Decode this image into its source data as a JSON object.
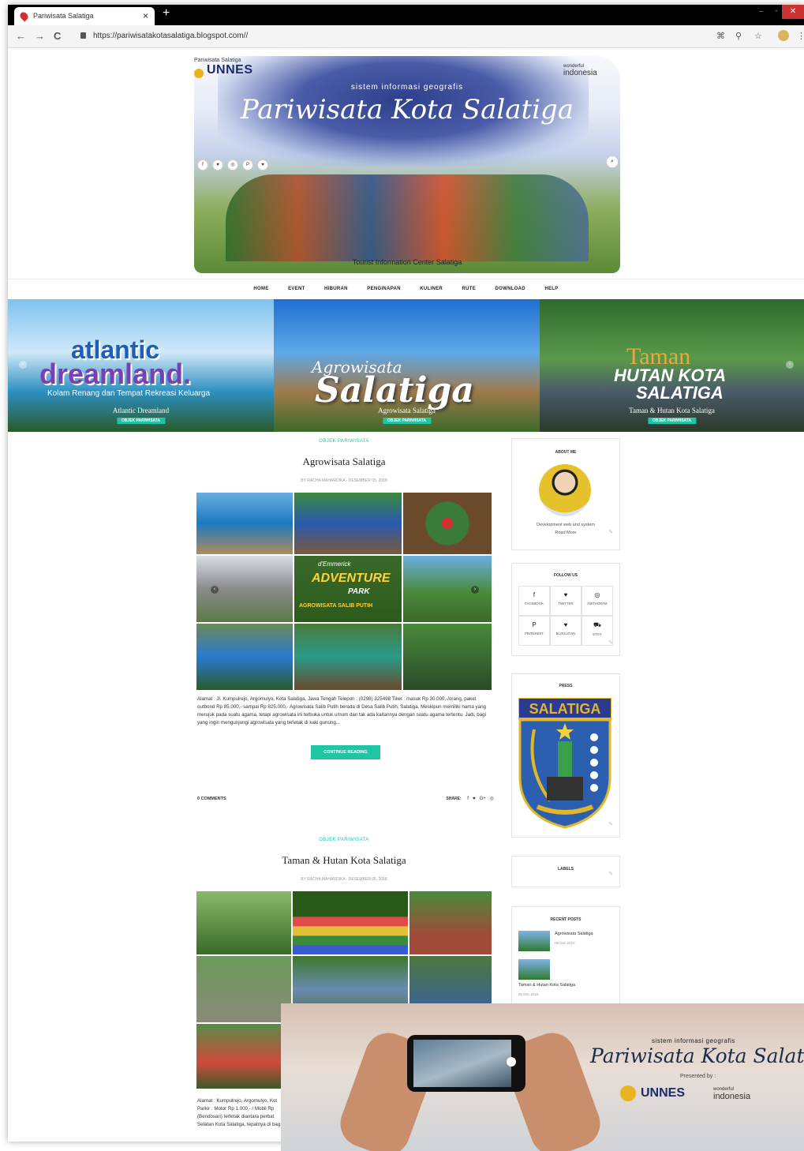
{
  "browser": {
    "tab_title": "Pariwisata Salatiga",
    "tab_close": "×",
    "new_tab": "+",
    "url": "https://pariwisatakotasalatiga.blogspot.com//",
    "back": "←",
    "forward": "→",
    "reload": "C",
    "icons": [
      "translate-icon",
      "zoom-icon",
      "star-icon",
      "profile-icon",
      "menu-icon"
    ]
  },
  "header": {
    "unnes_small": "Pariwisata Salatiga",
    "unnes_label": "UNNES",
    "wi_small": "wonderful",
    "wi_label": "indonesia",
    "subtitle": "sistem informasi geografis",
    "title": "Pariwisata Kota Salatiga",
    "bottom_tag": "Tourist Information Center Salatiga",
    "social": [
      "f",
      "♥",
      "◎",
      "P",
      "♥"
    ],
    "search": "⌕"
  },
  "nav": [
    "HOME",
    "EVENT",
    "HIBURAN",
    "PENGINAPAN",
    "KULINER",
    "RUTE",
    "DOWNLOAD",
    "HELP"
  ],
  "slider": [
    {
      "art1": "atlantic",
      "art2": "dreamland.",
      "art3": "Kolam Renang dan Tempat Rekreasi Keluarga",
      "caption": "Atlantic Dreamland",
      "badge": "OBJEK PARIWISATA"
    },
    {
      "art1": "Agrowisata",
      "art2": "Salatiga",
      "caption": "Agrowisata Salatiga",
      "badge": "OBJEK PARIWISATA"
    },
    {
      "art1": "Taman",
      "art2": "HUTAN KOTA",
      "art3": "SALATIGA",
      "caption": "Taman & Hutan Kota Salatiga",
      "badge": "OBJEK PARIWISATA"
    }
  ],
  "posts": [
    {
      "category": "OBJEK PARIWISATA",
      "title": "Agrowisata Salatiga",
      "meta": "BY RACHA MAHARDIKA - DESEMBER 05, 2018",
      "collage_text": [
        "d'Emmerick",
        "ADVENTURE",
        "PARK",
        "AGROWISATA SALIB PUTIH"
      ],
      "excerpt": "Alamat : Jl. Kumpulrejo, Argomulyo, Kota Salatiga, Jawa Tengah Telepon : (0298) 325498 Tiket : masuk Rp 30.000,-/orang, paket outbond Rp 85.000,- sampai Rp 825.000,- Agrowisata Salib Putih berada di Desa Salib Putih, Salatiga. Meskipun memiliki nama yang merujuk pada suatu agama, tetapi agrowisata ini terbuka untuk umum dan tak ada kaitannya dengan suatu agama tertentu. Jadi, bagi yang ingin mengunjungi agrowisata yang terletak di kaki gunung...",
      "button": "CONTINUE READING",
      "comments": "0 COMMENTS",
      "share": "SHARE:",
      "share_icons": [
        "f",
        "♥",
        "G+",
        "◎"
      ]
    },
    {
      "category": "OBJEK PARIWISATA",
      "title": "Taman & Hutan Kota Salatiga",
      "meta": "BY RACHA MAHARDIKA - DESEMBER 05, 2018",
      "excerpt_lines": [
        "Alamat : Kumpulrejo, Argomulyo, Kot",
        "Parkir : Motor Rp 1.000,- / Mobil Rp",
        "(Bendosari) terletak diantara perbat",
        "Selatan Kota Salatiga, tepatnya di bag"
      ]
    }
  ],
  "sidebar": {
    "about": {
      "title": "ABOUT ME",
      "desc": "Development web and system",
      "more": "Read More"
    },
    "follow": {
      "title": "FOLLOW US",
      "items": [
        {
          "icon": "f",
          "label": "FACEBOOK"
        },
        {
          "icon": "♥",
          "label": "TWITTER"
        },
        {
          "icon": "◎",
          "label": "INSTAGRAM"
        },
        {
          "icon": "P",
          "label": "PINTEREST"
        },
        {
          "icon": "♥",
          "label": "BLOGLOVIN"
        },
        {
          "icon": "⛟",
          "label": "ETSY"
        }
      ]
    },
    "press": {
      "title": "PRESS",
      "crest_text": "SALATIGA"
    },
    "labels": {
      "title": "LABELS"
    },
    "recent": {
      "title": "RECENT POSTS",
      "items": [
        {
          "title": "Agrowisata Salatiga",
          "date": "05 Dec 2018"
        },
        {
          "title": "Taman & Hutan Kota Salatiga",
          "date": "05 Dec 2018"
        }
      ]
    },
    "edit_icon": "✎"
  },
  "overlay": {
    "subtitle": "sistem informasi geografis",
    "title": "Pariwisata Kota Salatiga",
    "presented": "Presented by :",
    "unnes": "UNNES",
    "wi_small": "wonderful",
    "wi": "indonesia"
  },
  "colors": {
    "accent": "#1fc6a5",
    "brand_navy": "#1b2b6b",
    "chrome": "#000000"
  }
}
